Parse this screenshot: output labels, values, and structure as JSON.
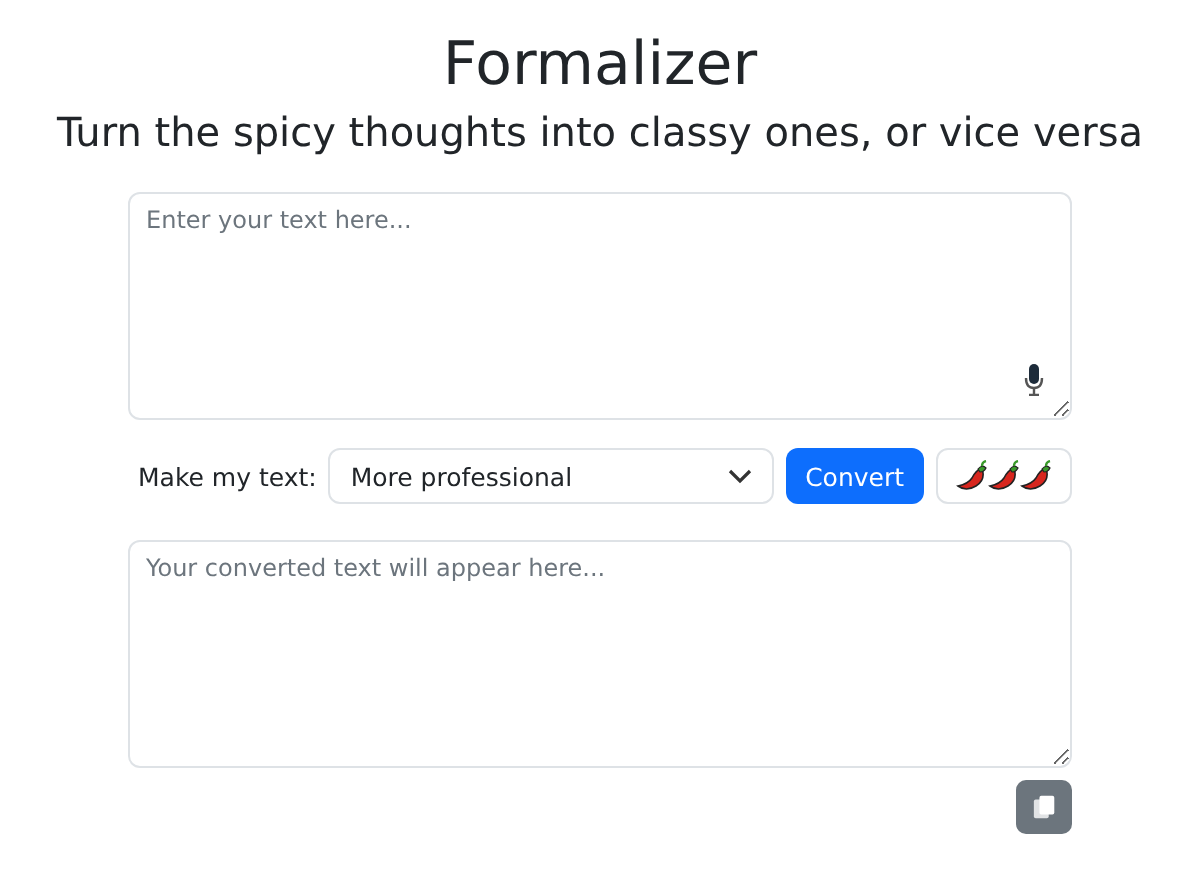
{
  "title": "Formalizer",
  "subtitle": "Turn the spicy thoughts into classy ones, or vice versa",
  "input": {
    "placeholder": "Enter your text here..."
  },
  "controls": {
    "label": "Make my text:",
    "select_value": "More professional",
    "convert_button": "Convert"
  },
  "output": {
    "placeholder": "Your converted text will appear here..."
  }
}
